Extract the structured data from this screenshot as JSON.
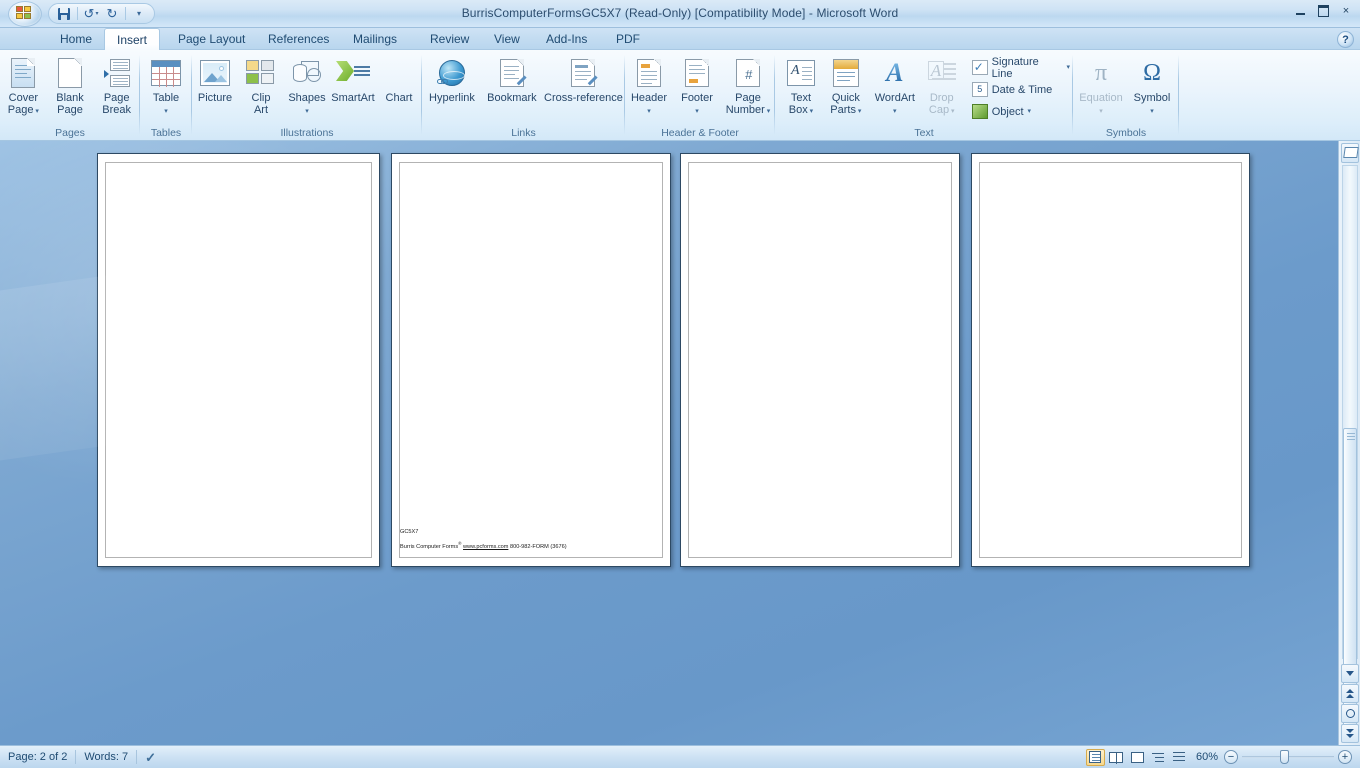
{
  "window": {
    "title": "BurrisComputerFormsGC5X7 (Read-Only) [Compatibility Mode] - Microsoft Word",
    "minimize_label": "Minimize",
    "maximize_label": "Maximize",
    "close_label": "×",
    "help_label": "?"
  },
  "quick_access": {
    "office_button": "Office Button",
    "save": "Save",
    "undo": "Undo",
    "redo": "Repeat",
    "customize": "Customize Quick Access Toolbar"
  },
  "tabs": [
    {
      "label": "Home",
      "active": false
    },
    {
      "label": "Insert",
      "active": true
    },
    {
      "label": "Page Layout",
      "active": false
    },
    {
      "label": "References",
      "active": false
    },
    {
      "label": "Mailings",
      "active": false
    },
    {
      "label": "Review",
      "active": false
    },
    {
      "label": "View",
      "active": false
    },
    {
      "label": "Add-Ins",
      "active": false
    },
    {
      "label": "PDF",
      "active": false
    }
  ],
  "ribbon": {
    "groups": [
      {
        "name": "Pages",
        "label": "Pages",
        "buttons": [
          {
            "label_line1": "Cover",
            "label_line2": "Page",
            "dropdown": true,
            "icon": "cover-page-icon"
          },
          {
            "label_line1": "Blank",
            "label_line2": "Page",
            "dropdown": false,
            "icon": "blank-page-icon"
          },
          {
            "label_line1": "Page",
            "label_line2": "Break",
            "dropdown": false,
            "icon": "page-break-icon"
          }
        ]
      },
      {
        "name": "Tables",
        "label": "Tables",
        "buttons": [
          {
            "label_line1": "Table",
            "label_line2": "",
            "dropdown": true,
            "icon": "table-icon"
          }
        ]
      },
      {
        "name": "Illustrations",
        "label": "Illustrations",
        "buttons": [
          {
            "label_line1": "Picture",
            "label_line2": "",
            "dropdown": false,
            "icon": "picture-icon"
          },
          {
            "label_line1": "Clip",
            "label_line2": "Art",
            "dropdown": false,
            "icon": "clip-art-icon"
          },
          {
            "label_line1": "Shapes",
            "label_line2": "",
            "dropdown": true,
            "icon": "shapes-icon"
          },
          {
            "label_line1": "SmartArt",
            "label_line2": "",
            "dropdown": false,
            "icon": "smartart-icon"
          },
          {
            "label_line1": "Chart",
            "label_line2": "",
            "dropdown": false,
            "icon": "chart-icon"
          }
        ]
      },
      {
        "name": "Links",
        "label": "Links",
        "buttons": [
          {
            "label_line1": "Hyperlink",
            "label_line2": "",
            "dropdown": false,
            "icon": "hyperlink-icon"
          },
          {
            "label_line1": "Bookmark",
            "label_line2": "",
            "dropdown": false,
            "icon": "bookmark-icon"
          },
          {
            "label_line1": "Cross-reference",
            "label_line2": "",
            "dropdown": false,
            "icon": "cross-reference-icon"
          }
        ]
      },
      {
        "name": "Header & Footer",
        "label": "Header & Footer",
        "buttons": [
          {
            "label_line1": "Header",
            "label_line2": "",
            "dropdown": true,
            "icon": "header-icon"
          },
          {
            "label_line1": "Footer",
            "label_line2": "",
            "dropdown": true,
            "icon": "footer-icon"
          },
          {
            "label_line1": "Page",
            "label_line2": "Number",
            "dropdown": true,
            "icon": "page-number-icon"
          }
        ]
      },
      {
        "name": "Text",
        "label": "Text",
        "buttons": [
          {
            "label_line1": "Text",
            "label_line2": "Box",
            "dropdown": true,
            "icon": "text-box-icon"
          },
          {
            "label_line1": "Quick",
            "label_line2": "Parts",
            "dropdown": true,
            "icon": "quick-parts-icon"
          },
          {
            "label_line1": "WordArt",
            "label_line2": "",
            "dropdown": true,
            "icon": "wordart-icon"
          },
          {
            "label_line1": "Drop",
            "label_line2": "Cap",
            "dropdown": true,
            "disabled": true,
            "icon": "drop-cap-icon"
          }
        ],
        "small_buttons": [
          {
            "label": "Signature Line",
            "dropdown": true,
            "icon": "signature-line-icon"
          },
          {
            "label": "Date & Time",
            "dropdown": false,
            "icon": "date-time-icon"
          },
          {
            "label": "Object",
            "dropdown": true,
            "icon": "object-icon"
          }
        ]
      },
      {
        "name": "Symbols",
        "label": "Symbols",
        "buttons": [
          {
            "label_line1": "Equation",
            "label_line2": "",
            "dropdown": true,
            "disabled": true,
            "icon": "equation-icon",
            "glyph": "π"
          },
          {
            "label_line1": "Symbol",
            "label_line2": "",
            "dropdown": true,
            "disabled": false,
            "icon": "symbol-icon",
            "glyph": "Ω"
          }
        ]
      }
    ]
  },
  "document": {
    "pages": [
      {
        "index": 1,
        "text_lines": []
      },
      {
        "index": 2,
        "text_lines": [
          "GC5X7",
          "Burris Computer Forms® www.pcforms.com 800-982-FORM (3676)"
        ]
      },
      {
        "index": 3,
        "text_lines": []
      },
      {
        "index": 4,
        "text_lines": []
      }
    ],
    "footer_code": "GC5X7",
    "footer_company": "Burris Computer Forms",
    "footer_sup": "®",
    "footer_url": "www.pcforms.com",
    "footer_phone": "800-982-FORM (3676)"
  },
  "status_bar": {
    "page": "Page: 2 of 2",
    "words": "Words: 7",
    "proofing": "Proofing errors icon",
    "zoom_level": "60%",
    "zoom_out": "−",
    "zoom_in": "+",
    "views": [
      {
        "name": "print-layout",
        "selected": true
      },
      {
        "name": "full-screen-reading",
        "selected": false
      },
      {
        "name": "web-layout",
        "selected": false
      },
      {
        "name": "outline",
        "selected": false
      },
      {
        "name": "draft",
        "selected": false
      }
    ]
  },
  "scrollbar": {
    "split_handle": "split-handle",
    "previous_page": "Previous Page",
    "select_browse_object": "Select Browse Object",
    "next_page": "Next Page"
  },
  "colors": {
    "accent": "#2a6099",
    "canvas": "#6c9bcb",
    "ribbon_bg": "#eaf4fc",
    "tab_active": "#ffffff"
  }
}
